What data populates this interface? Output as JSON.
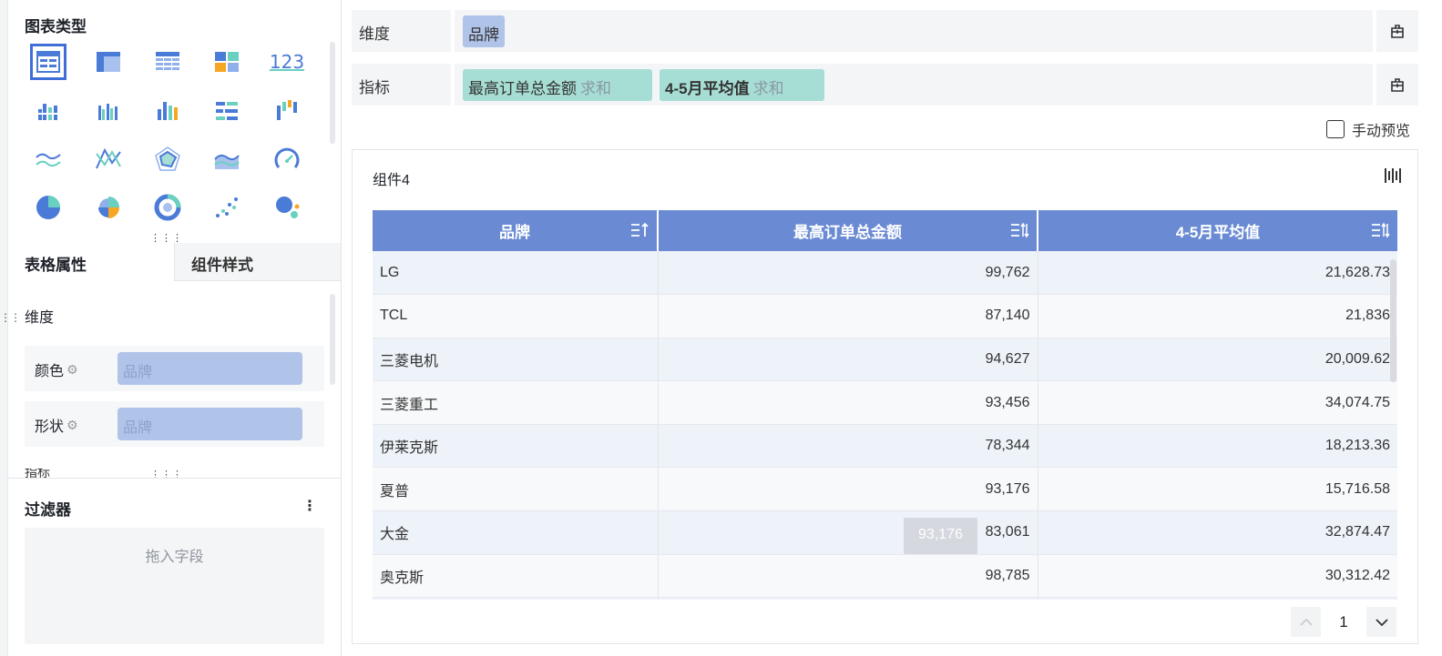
{
  "left": {
    "chart_type_title": "图表类型",
    "chart_types": [
      {
        "name": "table-detail-icon"
      },
      {
        "name": "table-grouped-icon"
      },
      {
        "name": "table-cross-icon"
      },
      {
        "name": "table-block-icon"
      },
      {
        "name": "kpi-number-icon",
        "text": "123"
      },
      {
        "name": "bar-grouped-icon"
      },
      {
        "name": "bar-multi-icon"
      },
      {
        "name": "bar-colored-icon"
      },
      {
        "name": "bar-horizontal-icon"
      },
      {
        "name": "bar-waterfall-icon"
      },
      {
        "name": "line-multi-icon"
      },
      {
        "name": "line-polyline-icon"
      },
      {
        "name": "radar-icon"
      },
      {
        "name": "area-icon"
      },
      {
        "name": "gauge-icon"
      },
      {
        "name": "pie-icon"
      },
      {
        "name": "rose-pie-icon"
      },
      {
        "name": "donut-icon"
      },
      {
        "name": "scatter-icon"
      },
      {
        "name": "bubble-icon"
      }
    ],
    "tabs": {
      "table_props": "表格属性",
      "component_style": "组件样式"
    },
    "dimension_label": "维度",
    "color_label": "颜色",
    "color_chip": "品牌",
    "shape_label": "形状",
    "shape_chip": "品牌",
    "cut_label": "指标",
    "filter_title": "过滤器",
    "filter_more": "⋮",
    "filter_placeholder": "拖入字段"
  },
  "shelves": {
    "dimension_label": "维度",
    "dimension_chip": "品牌",
    "metric_label": "指标",
    "metrics": [
      {
        "name": "最高订单总金额",
        "agg": "求和"
      },
      {
        "name": "4-5月平均值",
        "agg": "求和"
      }
    ]
  },
  "manual_preview": "手动预览",
  "widget": {
    "title": "组件4",
    "columns": [
      "品牌",
      "最高订单总金额",
      "4-5月平均值"
    ],
    "rows": [
      [
        "LG",
        "99,762",
        "21,628.73"
      ],
      [
        "TCL",
        "87,140",
        "21,836"
      ],
      [
        "三菱电机",
        "94,627",
        "20,009.62"
      ],
      [
        "三菱重工",
        "93,456",
        "34,074.75"
      ],
      [
        "伊莱克斯",
        "78,344",
        "18,213.36"
      ],
      [
        "夏普",
        "93,176",
        "15,716.58"
      ],
      [
        "大金",
        "83,061",
        "32,874.47"
      ],
      [
        "奥克斯",
        "98,785",
        "30,312.42"
      ]
    ],
    "tooltip": "93,176",
    "page": "1"
  },
  "colors": {
    "header_bg": "#6a8bd3",
    "dim_chip": "#b0c3e8",
    "metric_chip": "#a6ddd4",
    "selected_border": "#3f6fd6"
  }
}
